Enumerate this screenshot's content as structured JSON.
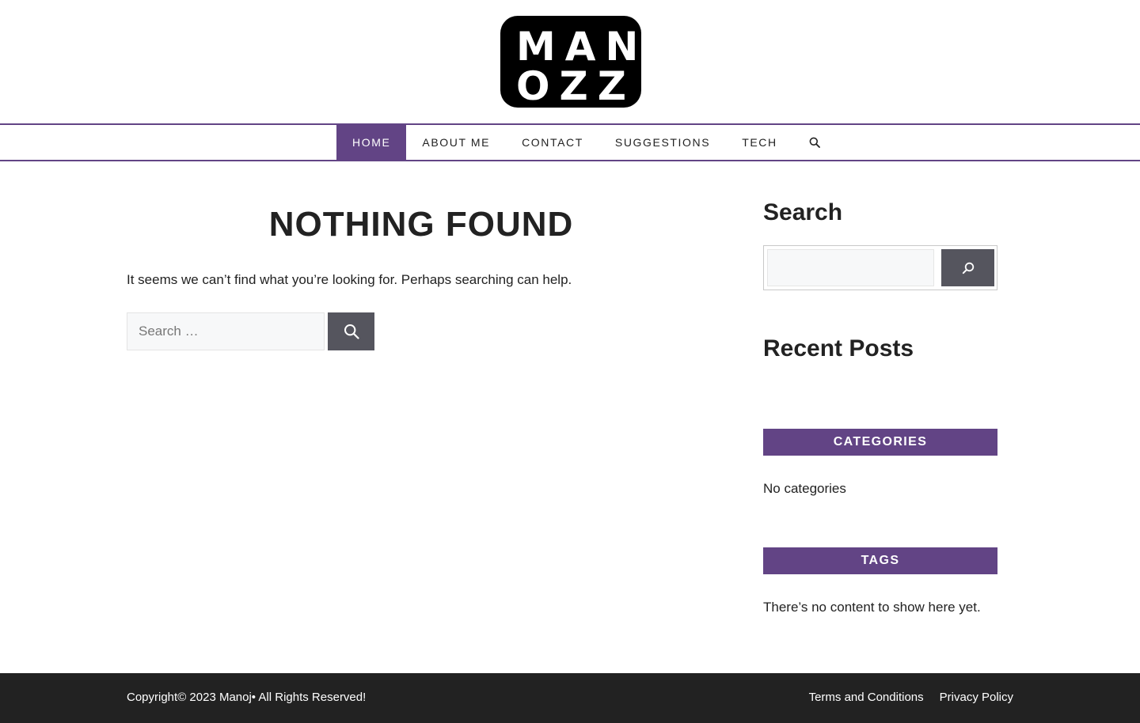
{
  "logo": {
    "line1": "MAN",
    "line2": "OZZ"
  },
  "nav": {
    "items": [
      {
        "label": "HOME"
      },
      {
        "label": "ABOUT ME"
      },
      {
        "label": "CONTACT"
      },
      {
        "label": "SUGGESTIONS"
      },
      {
        "label": "TECH"
      }
    ],
    "search_icon": "search-icon"
  },
  "main": {
    "title": "NOTHING FOUND",
    "message": "It seems we can’t find what you’re looking for. Perhaps searching can help.",
    "search_placeholder": "Search …",
    "search_button_icon": "search-icon"
  },
  "sidebar": {
    "search_title": "Search",
    "recent_posts_title": "Recent Posts",
    "categories_title": "CATEGORIES",
    "categories_text": "No categories",
    "tags_title": "TAGS",
    "tags_text": "There’s no content to show here yet."
  },
  "footer": {
    "copyright": "Copyright© 2023 Manoj• All Rights Reserved!",
    "links": [
      {
        "label": "Terms and Conditions"
      },
      {
        "label": "Privacy Policy"
      }
    ]
  },
  "colors": {
    "accent": "#624485",
    "button": "#55555e",
    "footer_bg": "#222222"
  }
}
